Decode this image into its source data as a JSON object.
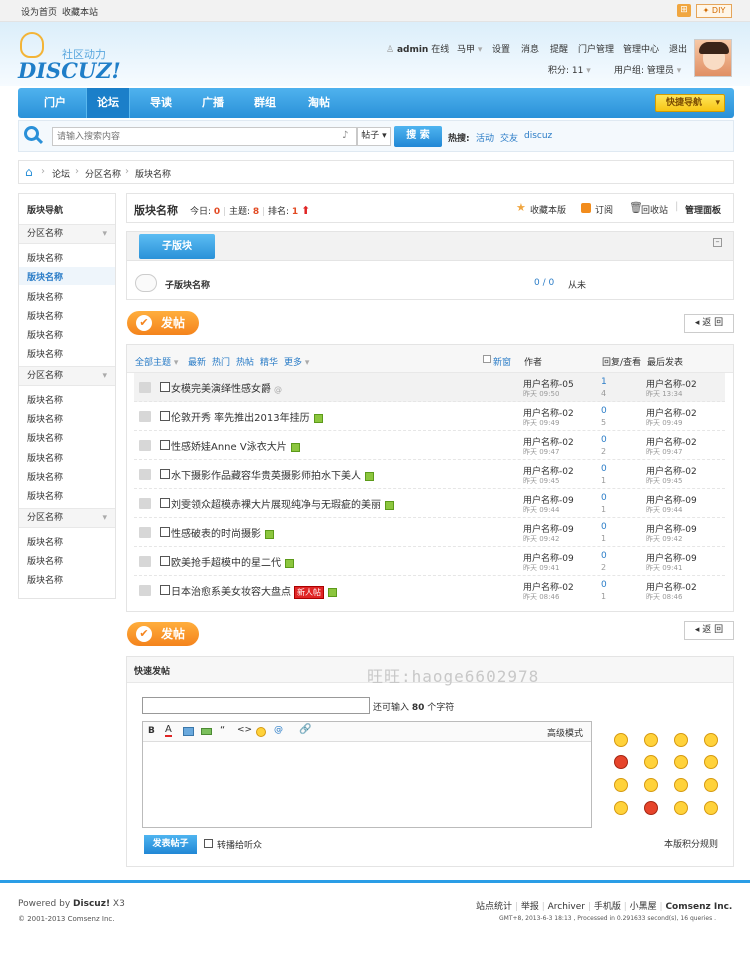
{
  "topbar": {
    "set_home": "设为首页",
    "bookmark": "收藏本站",
    "diy": "DIY"
  },
  "logo": {
    "text": "DISCUZ!",
    "sub": "社区动力"
  },
  "user": {
    "name": "admin",
    "status": "在线",
    "horse": "马甲",
    "settings": "设置",
    "messages": "消息",
    "remind": "提醒",
    "portal_manage": "门户管理",
    "manage_center": "管理中心",
    "logout": "退出",
    "credits": "积分: 11",
    "group": "用户组: 管理员"
  },
  "nav": {
    "items": [
      "门户",
      "论坛",
      "导读",
      "广播",
      "群组",
      "淘帖"
    ],
    "quick": "快捷导航"
  },
  "search": {
    "placeholder": "请输入搜索内容",
    "type": "帖子",
    "button": "搜 索",
    "hot_label": "热搜:",
    "hot": [
      "活动",
      "交友",
      "discuz"
    ]
  },
  "breadcrumb": [
    "论坛",
    "分区名称",
    "版块名称"
  ],
  "sidebar": {
    "title": "版块导航",
    "groups": [
      {
        "name": "分区名称",
        "items": [
          "版块名称",
          "版块名称",
          "版块名称",
          "版块名称",
          "版块名称",
          "版块名称"
        ]
      },
      {
        "name": "分区名称",
        "items": [
          "版块名称",
          "版块名称",
          "版块名称",
          "版块名称",
          "版块名称",
          "版块名称"
        ]
      },
      {
        "name": "分区名称",
        "items": [
          "版块名称",
          "版块名称",
          "版块名称"
        ]
      }
    ]
  },
  "forum": {
    "name": "版块名称",
    "today_label": "今日:",
    "today": "0",
    "topics_label": "主题:",
    "topics": "8",
    "rank_label": "排名:",
    "rank": "1",
    "fav": "收藏本版",
    "rss": "订阅",
    "recycle": "回收站",
    "manage": "管理面板"
  },
  "subforum": {
    "tab": "子版块",
    "name": "子版块名称",
    "count": "0 / 0",
    "last": "从未"
  },
  "post_btn": "发帖",
  "back_btn": "返 回",
  "filters": {
    "all": "全部主题",
    "newest": "最新",
    "hot": "热门",
    "hotpost": "热帖",
    "digest": "精华",
    "more": "更多",
    "new_win": "新窗",
    "author": "作者",
    "reply_view": "回复/查看",
    "last_post": "最后发表"
  },
  "threads": [
    {
      "title": "女模完美演绎性感女爵",
      "author": "用户名称-05",
      "time": "昨天 09:50",
      "replies": "1",
      "views": "4",
      "last_user": "用户名称-02",
      "last_time": "昨天 13:34",
      "attach": false,
      "new": false
    },
    {
      "title": "伦敦开秀 率先推出2013年挂历",
      "author": "用户名称-02",
      "time": "昨天 09:49",
      "replies": "0",
      "views": "5",
      "last_user": "用户名称-02",
      "last_time": "昨天 09:49",
      "attach": true,
      "new": false
    },
    {
      "title": "性感娇娃Anne V泳衣大片",
      "author": "用户名称-02",
      "time": "昨天 09:47",
      "replies": "0",
      "views": "2",
      "last_user": "用户名称-02",
      "last_time": "昨天 09:47",
      "attach": true,
      "new": false
    },
    {
      "title": "水下摄影作品藏容华贵英摄影师拍水下美人",
      "author": "用户名称-02",
      "time": "昨天 09:45",
      "replies": "0",
      "views": "1",
      "last_user": "用户名称-02",
      "last_time": "昨天 09:45",
      "attach": true,
      "new": false
    },
    {
      "title": "刘雯领众超模赤裸大片展现纯净与无瑕疵的美丽",
      "author": "用户名称-09",
      "time": "昨天 09:44",
      "replies": "0",
      "views": "1",
      "last_user": "用户名称-09",
      "last_time": "昨天 09:44",
      "attach": true,
      "new": false
    },
    {
      "title": "性感破表的时尚摄影",
      "author": "用户名称-09",
      "time": "昨天 09:42",
      "replies": "0",
      "views": "1",
      "last_user": "用户名称-09",
      "last_time": "昨天 09:42",
      "attach": true,
      "new": false
    },
    {
      "title": "欧美抢手超模中的星二代",
      "author": "用户名称-09",
      "time": "昨天 09:41",
      "replies": "0",
      "views": "2",
      "last_user": "用户名称-09",
      "last_time": "昨天 09:41",
      "attach": true,
      "new": false
    },
    {
      "title": "日本治愈系美女妆容大盘点",
      "author": "用户名称-02",
      "time": "昨天 08:46",
      "replies": "0",
      "views": "1",
      "last_user": "用户名称-02",
      "last_time": "昨天 08:46",
      "attach": true,
      "new": true,
      "new_text": "新人帖"
    }
  ],
  "quick": {
    "title": "快速发帖",
    "limit_pre": "还可输入",
    "limit": "80",
    "limit_post": "个字符",
    "advanced": "高级模式",
    "submit": "发表帖子",
    "share": "转播给听众",
    "rules": "本版积分规则",
    "watermark": "旺旺:haoge6602978"
  },
  "footer": {
    "powered_pre": "Powered by",
    "powered_brand": "Discuz!",
    "powered_ver": "X3",
    "copyright": "© 2001-2013 Comsenz Inc.",
    "links": [
      "站点统计",
      "举报",
      "Archiver",
      "手机版",
      "小黑屋"
    ],
    "company": "Comsenz Inc.",
    "info": "GMT+8, 2013-6-3 18:13 , Processed in 0.291633 second(s), 16 queries ."
  }
}
